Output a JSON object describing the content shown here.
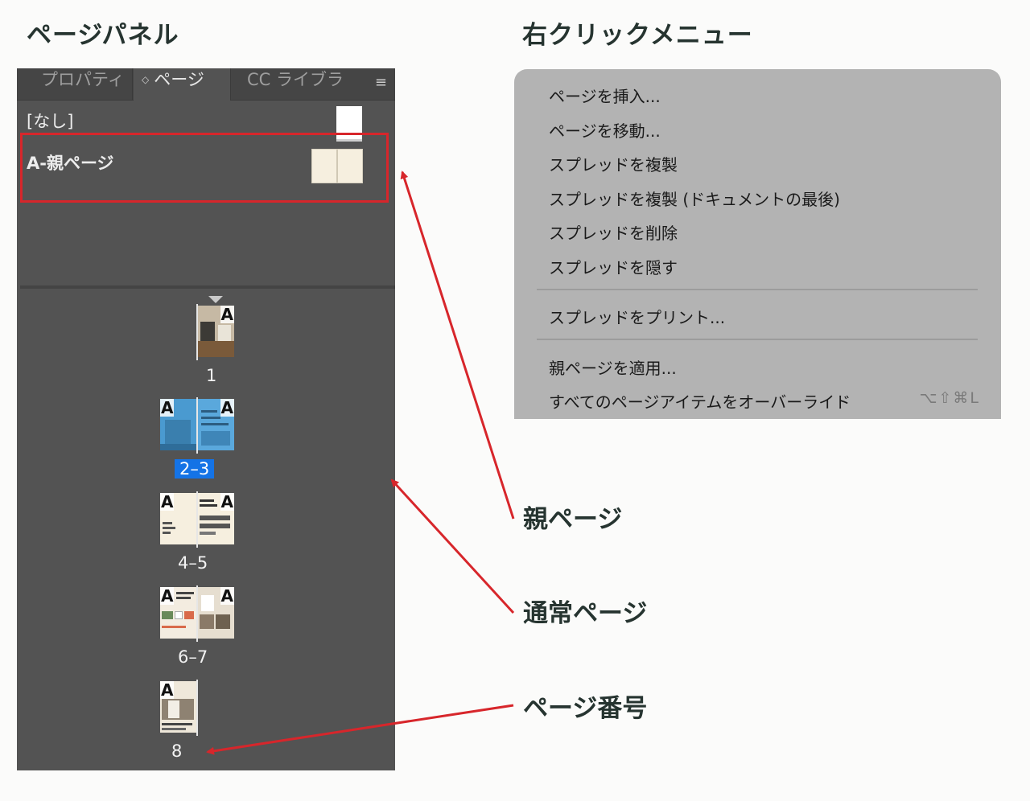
{
  "headings": {
    "pages_panel": "ページパネル",
    "context_menu": "右クリックメニュー"
  },
  "panel": {
    "tabs": [
      {
        "label": "プロパティ"
      },
      {
        "label": "ページ",
        "active": true
      },
      {
        "label": "CC ライブラリ"
      }
    ],
    "menu_icon": "hamburger-icon",
    "parents": [
      {
        "label": "[なし]"
      },
      {
        "label": "A-親ページ"
      }
    ],
    "spreads": [
      {
        "pages": "1",
        "selected": false
      },
      {
        "pages": "2–3",
        "selected": true
      },
      {
        "pages": "4–5",
        "selected": false
      },
      {
        "pages": "6–7",
        "selected": false
      },
      {
        "pages": "8",
        "selected": false
      }
    ],
    "master_letter": "A"
  },
  "context_menu": {
    "items": [
      {
        "label": "ページを挿入..."
      },
      {
        "label": "ページを移動..."
      },
      {
        "label": "スプレッドを複製"
      },
      {
        "label": "スプレッドを複製 (ドキュメントの最後)"
      },
      {
        "label": "スプレッドを削除"
      },
      {
        "label": "スプレッドを隠す"
      },
      {
        "label": "スプレッドをプリント..."
      },
      {
        "label": "親ページを適用..."
      },
      {
        "label": "すべてのページアイテムをオーバーライド",
        "shortcut": "⌥⇧⌘L"
      }
    ]
  },
  "annotations": {
    "parent_page": "親ページ",
    "normal_page": "通常ページ",
    "page_number": "ページ番号"
  },
  "colors": {
    "panel_bg": "#535353",
    "menu_bg": "#b3b3b3",
    "accent_red": "#d7262b",
    "selection_blue": "#1473e6"
  }
}
